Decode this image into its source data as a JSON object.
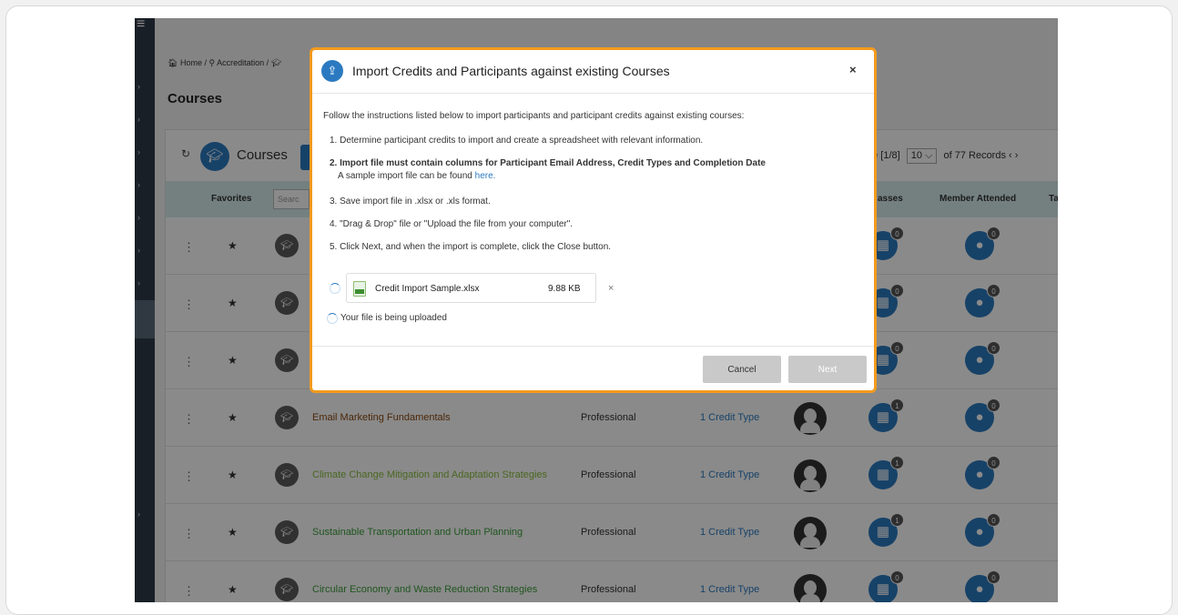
{
  "breadcrumb": {
    "home": "Home",
    "sep": "/",
    "section": "Accreditation"
  },
  "page_title": "Courses",
  "card": {
    "title": "Courses",
    "pager": {
      "page_text": "ge [1/8]",
      "page_size": "10",
      "records": "of 77 Records"
    }
  },
  "table": {
    "headers": {
      "favorites": "Favorites",
      "search_placeholder": "Searc",
      "classes": "asses",
      "member_attended": "Member Attended",
      "tail": "Ta"
    },
    "rows": [
      {
        "name": "",
        "type": "",
        "credit": "",
        "classes": "0",
        "members": "0",
        "color": "#8bbf3f"
      },
      {
        "name": "",
        "type": "",
        "credit": "",
        "classes": "0",
        "members": "0",
        "color": "#8bbf3f"
      },
      {
        "name": "",
        "type": "",
        "credit": "",
        "classes": "0",
        "members": "0",
        "color": "#8bbf3f"
      },
      {
        "name": "Email Marketing Fundamentals",
        "type": "Professional",
        "credit": "1 Credit Type",
        "classes": "1",
        "members": "0",
        "color": "#8a4a13"
      },
      {
        "name": "Climate Change Mitigation and Adaptation Strategies",
        "type": "Professional",
        "credit": "1 Credit Type",
        "classes": "1",
        "members": "0",
        "color": "#8bbf3f"
      },
      {
        "name": "Sustainable Transportation and Urban Planning",
        "type": "Professional",
        "credit": "1 Credit Type",
        "classes": "1",
        "members": "0",
        "color": "#3c9f3a"
      },
      {
        "name": "Circular Economy and Waste Reduction Strategies",
        "type": "Professional",
        "credit": "1 Credit Type",
        "classes": "0",
        "members": "0",
        "color": "#3c9f3a"
      }
    ]
  },
  "modal": {
    "title": "Import Credits and Participants against existing Courses",
    "close": "×",
    "intro": "Follow the instructions listed below to import participants and participant credits against existing courses:",
    "steps": {
      "s1": "1. Determine participant credits to import and create a spreadsheet with relevant information.",
      "s2_bold": "2. Import file must contain columns for Participant Email Address, Credit Types and Completion Date",
      "s2_sub": "A sample import file can be found ",
      "s2_link": "here.",
      "s3": "3. Save import file in .xlsx or .xls format.",
      "s4": "4. \"Drag & Drop\" file or \"Upload the file from your computer\".",
      "s5": "5. Click Next, and when the import is complete, click the Close button."
    },
    "file": {
      "name": "Credit Import Sample.xlsx",
      "size": "9.88 KB",
      "remove": "×"
    },
    "upload_status": "Your file is being uploaded",
    "cancel_label": "Cancel",
    "next_label": "Next"
  },
  "colors": {
    "accent": "#2b7ac1",
    "highlight": "#f39a1d",
    "header_row": "#d7ecec"
  }
}
